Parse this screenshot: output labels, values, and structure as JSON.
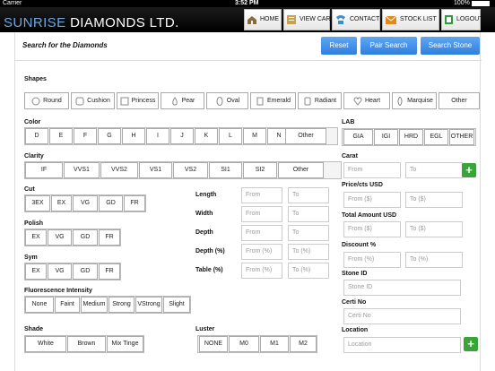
{
  "status": {
    "carrier": "Carrier",
    "time": "3:52 PM",
    "battery": "100%"
  },
  "brand": {
    "name": "SUNRISE",
    "rest": "DIAMONDS LTD."
  },
  "nav": {
    "home": "HOME",
    "cart": "VIEW CART",
    "contact": "CONTACT",
    "stock": "STOCK LIST",
    "logout": "LOGOUT"
  },
  "page": {
    "title": "Search for the Diamonds",
    "reset": "Reset",
    "pair": "Pair Search",
    "search": "Search Stone"
  },
  "shapes": {
    "label": "Shapes",
    "items": [
      "Round",
      "Cushion",
      "Princess",
      "Pear",
      "Oval",
      "Emerald",
      "Radiant",
      "Heart",
      "Marquise",
      "Other"
    ]
  },
  "color": {
    "label": "Color",
    "items": [
      "D",
      "E",
      "F",
      "G",
      "H",
      "I",
      "J",
      "K",
      "L",
      "M",
      "N",
      "Other"
    ]
  },
  "clarity": {
    "label": "Clarity",
    "items": [
      "IF",
      "VVS1",
      "VVS2",
      "VS1",
      "VS2",
      "SI1",
      "SI2",
      "Other"
    ]
  },
  "cut": {
    "label": "Cut",
    "items": [
      "3EX",
      "EX",
      "VG",
      "GD",
      "FR"
    ]
  },
  "polish": {
    "label": "Polish",
    "items": [
      "EX",
      "VG",
      "GD",
      "FR"
    ]
  },
  "sym": {
    "label": "Sym",
    "items": [
      "EX",
      "VG",
      "GD",
      "FR"
    ]
  },
  "fluor": {
    "label": "Fluorescence Intensity",
    "items": [
      "None",
      "Faint",
      "Medium",
      "Strong",
      "VStrong",
      "Slight"
    ]
  },
  "shade": {
    "label": "Shade",
    "items": [
      "White",
      "Brown",
      "Mix Tinge"
    ]
  },
  "luster": {
    "label": "Luster",
    "items": [
      "NONE",
      "M0",
      "M1",
      "M2"
    ]
  },
  "measure": {
    "rows": [
      {
        "label": "Length",
        "from": "From",
        "to": "To"
      },
      {
        "label": "Width",
        "from": "From",
        "to": "To"
      },
      {
        "label": "Depth",
        "from": "From",
        "to": "To"
      },
      {
        "label": "Depth (%)",
        "from": "From (%)",
        "to": "To (%)"
      },
      {
        "label": "Table (%)",
        "from": "From (%)",
        "to": "To (%)"
      }
    ]
  },
  "lab": {
    "label": "LAB",
    "items": [
      "GIA",
      "IGI",
      "HRD",
      "EGL",
      "OTHER"
    ]
  },
  "carat": {
    "label": "Carat",
    "from": "From",
    "to": "To"
  },
  "price": {
    "label": "Price/cts USD",
    "from": "From ($)",
    "to": "To ($)"
  },
  "total": {
    "label": "Total Amount USD",
    "from": "From ($)",
    "to": "To ($)"
  },
  "discount": {
    "label": "Discount %",
    "from": "From (%)",
    "to": "To (%)"
  },
  "stone": {
    "label": "Stone ID",
    "placeholder": "Stone ID"
  },
  "certi": {
    "label": "Certi No",
    "placeholder": "Certi No"
  },
  "location": {
    "label": "Location",
    "placeholder": "Location"
  },
  "colors": {
    "accent": "#2f7fe0",
    "header": "#000000",
    "brand_blue": "#6fa6dd",
    "plus_green": "#3aa33a"
  }
}
